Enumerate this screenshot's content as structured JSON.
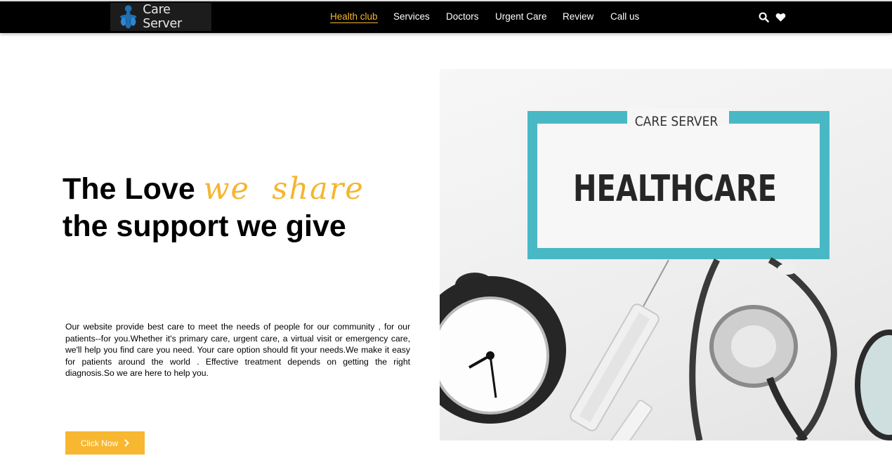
{
  "brand": {
    "name": "Care Server",
    "logo_icon": "cross-logo-icon"
  },
  "nav": {
    "items": [
      {
        "label": "Health club",
        "active": true
      },
      {
        "label": "Services"
      },
      {
        "label": "Doctors"
      },
      {
        "label": "Urgent Care"
      },
      {
        "label": "Review"
      },
      {
        "label": "Call us"
      }
    ],
    "icons": [
      "search-icon",
      "heart-icon"
    ]
  },
  "hero": {
    "line1_start": "The Love",
    "line1_accent": "we  share",
    "line2": "the support we give",
    "intro": "Our website provide best care to meet the needs of people for our community , for our patients--for you.Whether it's primary care, urgent care, a virtual visit or emergency care, we'll help you find care you need. Your care option should fit your needs.We make it easy for patients around the world . Effective treatment depends on getting the right diagnosis.So we are here to help you.",
    "cta_label": "Click Now",
    "cta_icon": "chevron-right-icon"
  },
  "hero_image": {
    "frame_top_text": "CARE SERVER",
    "frame_title": "HEALTHCARE"
  },
  "colors": {
    "accent": "#f5b52e",
    "topbar": "#000000",
    "frame": "#4bb9c6"
  }
}
